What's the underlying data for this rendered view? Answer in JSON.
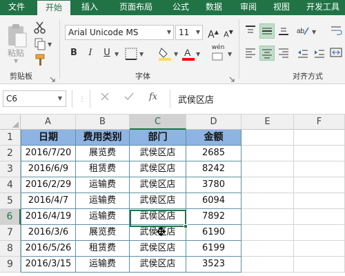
{
  "tabs": [
    "文件",
    "开始",
    "插入",
    "页面布局",
    "公式",
    "数据",
    "审阅",
    "视图",
    "开发工具"
  ],
  "active_tab": "开始",
  "ribbon": {
    "clipboard": {
      "paste_label": "粘贴",
      "group_label": "剪贴板"
    },
    "font": {
      "font_name": "Arial Unicode MS",
      "font_size": "11",
      "group_label": "字体",
      "pinyin_label": "wén",
      "fill_color": "#ffd966",
      "font_color": "#ff0000"
    },
    "alignment": {
      "group_label": "对齐方式"
    }
  },
  "formula_bar": {
    "name_box": "C6",
    "fx_label": "fx",
    "content": "武侯区店"
  },
  "grid": {
    "columns": [
      "A",
      "B",
      "C",
      "D",
      "E",
      "F"
    ],
    "selected_column": "C",
    "rows": [
      "1",
      "2",
      "3",
      "4",
      "5",
      "6",
      "7",
      "8",
      "9"
    ],
    "selected_row": "6",
    "headers": [
      "日期",
      "费用类别",
      "部门",
      "金额"
    ],
    "data": [
      [
        "2016/7/20",
        "展览费",
        "武侯区店",
        "2685"
      ],
      [
        "2016/6/9",
        "租赁费",
        "武侯区店",
        "8242"
      ],
      [
        "2016/2/29",
        "运输费",
        "武侯区店",
        "3780"
      ],
      [
        "2016/4/7",
        "运输费",
        "武侯区店",
        "6094"
      ],
      [
        "2016/4/19",
        "运输费",
        "武侯区店",
        "7892"
      ],
      [
        "2016/3/6",
        "展览费",
        "武侯区店",
        "6190"
      ],
      [
        "2016/5/26",
        "租赁费",
        "武侯区店",
        "6199"
      ],
      [
        "2016/3/15",
        "运输费",
        "武侯区店",
        "3523"
      ]
    ],
    "header_fill": "#8db4e2",
    "selection_color": "#217346"
  }
}
